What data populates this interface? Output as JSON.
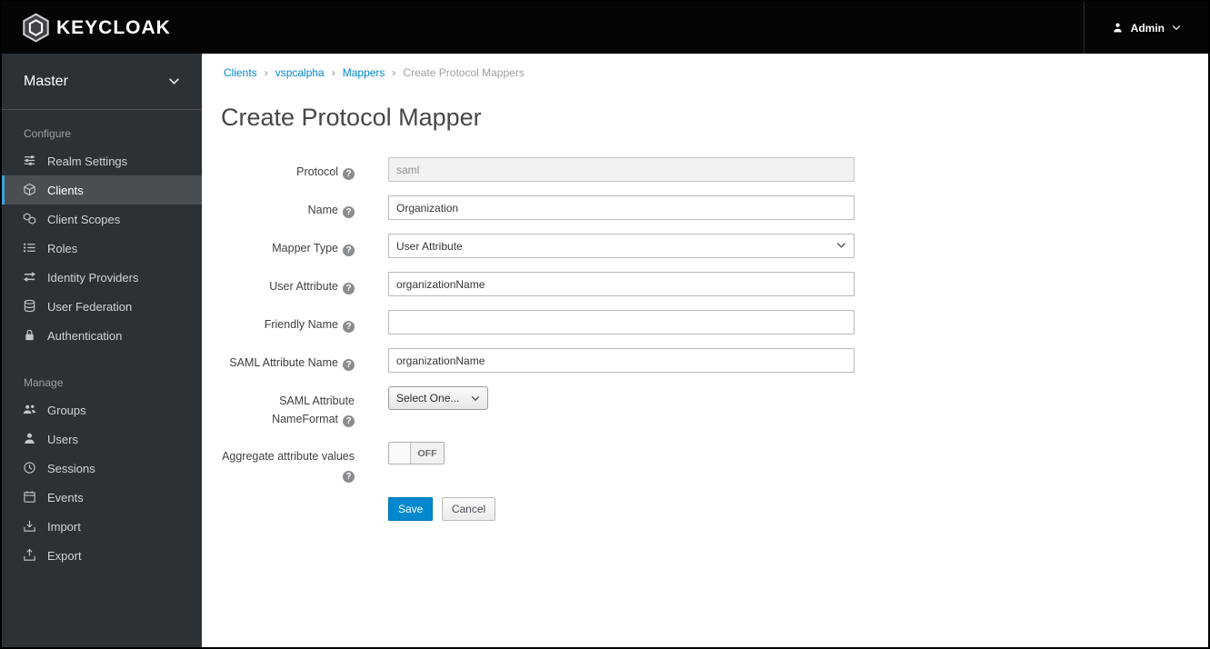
{
  "topbar": {
    "brand": "KEYCLOAK",
    "user": {
      "label": "Admin"
    }
  },
  "sidebar": {
    "realm_selector": {
      "label": "Master"
    },
    "sections": [
      {
        "heading": "Configure",
        "items": [
          {
            "label": "Realm Settings",
            "icon": "sliders-icon",
            "active": false
          },
          {
            "label": "Clients",
            "icon": "cube-icon",
            "active": true
          },
          {
            "label": "Client Scopes",
            "icon": "cubes-icon",
            "active": false
          },
          {
            "label": "Roles",
            "icon": "list-icon",
            "active": false
          },
          {
            "label": "Identity Providers",
            "icon": "exchange-icon",
            "active": false
          },
          {
            "label": "User Federation",
            "icon": "database-icon",
            "active": false
          },
          {
            "label": "Authentication",
            "icon": "lock-icon",
            "active": false
          }
        ]
      },
      {
        "heading": "Manage",
        "items": [
          {
            "label": "Groups",
            "icon": "groups-icon",
            "active": false
          },
          {
            "label": "Users",
            "icon": "user-icon",
            "active": false
          },
          {
            "label": "Sessions",
            "icon": "clock-icon",
            "active": false
          },
          {
            "label": "Events",
            "icon": "calendar-icon",
            "active": false
          },
          {
            "label": "Import",
            "icon": "import-icon",
            "active": false
          },
          {
            "label": "Export",
            "icon": "export-icon",
            "active": false
          }
        ]
      }
    ]
  },
  "breadcrumb": {
    "items": [
      {
        "label": "Clients",
        "link": true
      },
      {
        "label": "vspcalpha",
        "link": true
      },
      {
        "label": "Mappers",
        "link": true
      },
      {
        "label": "Create Protocol Mappers",
        "link": false
      }
    ]
  },
  "page": {
    "title": "Create Protocol Mapper",
    "form": {
      "protocol": {
        "label": "Protocol",
        "value": "saml",
        "disabled": true
      },
      "name": {
        "label": "Name",
        "value": "Organization"
      },
      "mapper_type": {
        "label": "Mapper Type",
        "value": "User Attribute"
      },
      "user_attribute": {
        "label": "User Attribute",
        "value": "organizationName"
      },
      "friendly_name": {
        "label": "Friendly Name",
        "value": ""
      },
      "saml_attribute_name": {
        "label": "SAML Attribute Name",
        "value": "organizationName"
      },
      "saml_attribute_nameformat": {
        "label": "SAML Attribute NameFormat",
        "value": "Select One..."
      },
      "aggregate_attribute_values": {
        "label": "Aggregate attribute values",
        "toggle_state": "OFF"
      },
      "buttons": {
        "save": "Save",
        "cancel": "Cancel"
      }
    }
  },
  "icons": {
    "help": "?"
  },
  "colors": {
    "accent_blue": "#0088ce",
    "active_nav_border": "#39a5dc",
    "topbar_bg": "#050505",
    "sidebar_bg": "#2c3136",
    "active_item_bg": "#494e53"
  }
}
